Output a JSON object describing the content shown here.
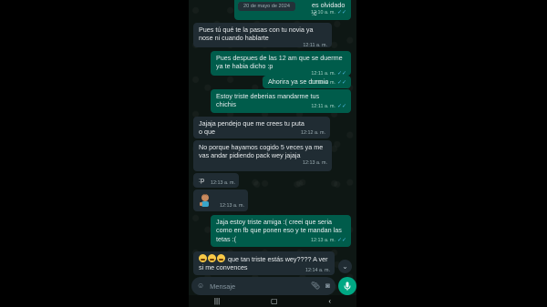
{
  "date_pill": "20 de mayo de 2024",
  "top_partial": {
    "prefix": "H",
    "text": "es olvidado :c",
    "time": "12:10 a. m."
  },
  "messages": [
    {
      "dir": "in",
      "text": "Pues tú qué te la pasas con tu novia ya nose ni cuando hablarte",
      "time": "12:11 a. m."
    },
    {
      "dir": "out",
      "text": "Pues despues de las 12 am que se duerme ya te habia dicho :p",
      "time": "12:11 a. m."
    },
    {
      "dir": "out",
      "text": "Ahorira ya se durmio",
      "time": "12:11 a. m."
    },
    {
      "dir": "out",
      "text": "Estoy triste deberias mandarme tus chichis",
      "time": "12:11 a. m."
    },
    {
      "dir": "in",
      "text": "Jajaja pendejo que me crees tu puta o que",
      "time": "12:12 a. m."
    },
    {
      "dir": "in",
      "text": "No porque hayamos cogido 5 veces ya me vas andar pidiendo pack wey jajaja",
      "time": "12:13 a. m."
    },
    {
      "dir": "in",
      "text": ":p",
      "time": "12:13 a. m."
    },
    {
      "dir": "in",
      "text": "",
      "time": "12:13 a. m."
    },
    {
      "dir": "out",
      "text": "Jaja estoy triste amiga :( creei que seria como en fb que ponen eso y te mandan las tetas :(",
      "time": "12:13 a. m."
    },
    {
      "dir": "in",
      "text": "que tan triste estás wey???? A ver si me convences",
      "time": "12:14 a. m."
    }
  ],
  "composer": {
    "placeholder": "Mensaje"
  },
  "icons": {
    "emoji": "smiley-icon",
    "attach": "paperclip-icon",
    "camera": "camera-icon",
    "mic": "mic-icon",
    "scroll": "chevron-down-icon"
  },
  "colors": {
    "incoming": "#202c33",
    "outgoing": "#005c4b",
    "accent": "#00a884",
    "ticks": "#53bdeb"
  }
}
